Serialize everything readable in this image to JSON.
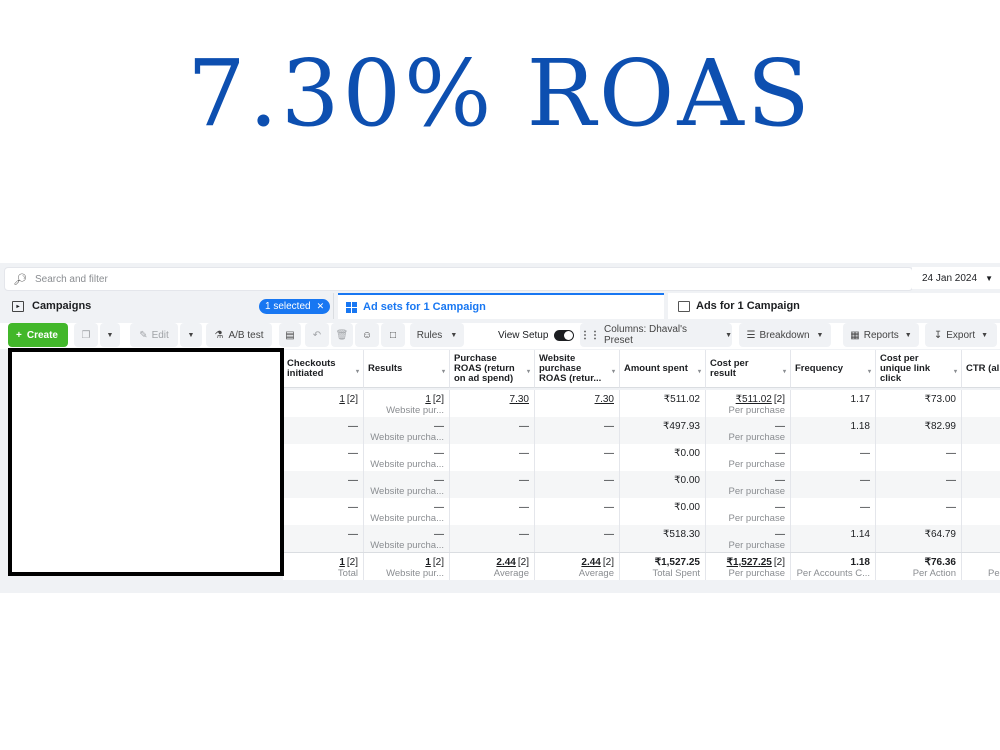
{
  "headline": "7.30% ROAS",
  "search": {
    "placeholder": "Search and filter",
    "date": "24 Jan 2024"
  },
  "tabs": {
    "campaigns": "Campaigns",
    "selected_badge": "1 selected",
    "adsets": "Ad sets for 1 Campaign",
    "ads": "Ads for 1 Campaign"
  },
  "toolbar": {
    "create": "Create",
    "edit": "Edit",
    "ab_test": "A/B test",
    "rules": "Rules",
    "view_setup": "View Setup",
    "columns": "Columns: Dhaval's Preset",
    "breakdown": "Breakdown",
    "reports": "Reports",
    "export": "Export"
  },
  "columns": [
    {
      "l1": "Checkouts",
      "l2": "initiated",
      "l3": ""
    },
    {
      "l1": "Results",
      "l2": "",
      "l3": ""
    },
    {
      "l1": "Purchase",
      "l2": "ROAS (return",
      "l3": "on ad spend)"
    },
    {
      "l1": "Website",
      "l2": "purchase",
      "l3": "ROAS (retur..."
    },
    {
      "l1": "Amount spent",
      "l2": "",
      "l3": ""
    },
    {
      "l1": "Cost per",
      "l2": "result",
      "l3": ""
    },
    {
      "l1": "Frequency",
      "l2": "",
      "l3": ""
    },
    {
      "l1": "Cost per",
      "l2": "unique link",
      "l3": "click"
    },
    {
      "l1": "CTR (al",
      "l2": "",
      "l3": ""
    }
  ],
  "rows": [
    [
      {
        "top": "1",
        "note": "[2]",
        "sub": ""
      },
      {
        "top": "1",
        "note": "[2]",
        "sub": "Website pur..."
      },
      {
        "top": "7.30",
        "note": "",
        "sub": ""
      },
      {
        "top": "7.30",
        "note": "",
        "sub": ""
      },
      {
        "top": "₹511.02",
        "note": "",
        "sub": ""
      },
      {
        "top": "₹511.02",
        "note": "[2]",
        "sub": "Per purchase"
      },
      {
        "top": "1.17",
        "note": "",
        "sub": ""
      },
      {
        "top": "₹73.00",
        "note": "",
        "sub": ""
      },
      {
        "top": "",
        "note": "",
        "sub": ""
      }
    ],
    [
      {
        "top": "—",
        "note": "",
        "sub": ""
      },
      {
        "top": "—",
        "note": "",
        "sub": "Website purcha..."
      },
      {
        "top": "—",
        "note": "",
        "sub": ""
      },
      {
        "top": "—",
        "note": "",
        "sub": ""
      },
      {
        "top": "₹497.93",
        "note": "",
        "sub": ""
      },
      {
        "top": "—",
        "note": "",
        "sub": "Per purchase"
      },
      {
        "top": "1.18",
        "note": "",
        "sub": ""
      },
      {
        "top": "₹82.99",
        "note": "",
        "sub": ""
      },
      {
        "top": "",
        "note": "",
        "sub": ""
      }
    ],
    [
      {
        "top": "—",
        "note": "",
        "sub": ""
      },
      {
        "top": "—",
        "note": "",
        "sub": "Website purcha..."
      },
      {
        "top": "—",
        "note": "",
        "sub": ""
      },
      {
        "top": "—",
        "note": "",
        "sub": ""
      },
      {
        "top": "₹0.00",
        "note": "",
        "sub": ""
      },
      {
        "top": "—",
        "note": "",
        "sub": "Per purchase"
      },
      {
        "top": "—",
        "note": "",
        "sub": ""
      },
      {
        "top": "—",
        "note": "",
        "sub": ""
      },
      {
        "top": "—",
        "note": "",
        "sub": ""
      }
    ],
    [
      {
        "top": "—",
        "note": "",
        "sub": ""
      },
      {
        "top": "—",
        "note": "",
        "sub": "Website purcha..."
      },
      {
        "top": "—",
        "note": "",
        "sub": ""
      },
      {
        "top": "—",
        "note": "",
        "sub": ""
      },
      {
        "top": "₹0.00",
        "note": "",
        "sub": ""
      },
      {
        "top": "—",
        "note": "",
        "sub": "Per purchase"
      },
      {
        "top": "—",
        "note": "",
        "sub": ""
      },
      {
        "top": "—",
        "note": "",
        "sub": ""
      },
      {
        "top": "—",
        "note": "",
        "sub": ""
      }
    ],
    [
      {
        "top": "—",
        "note": "",
        "sub": ""
      },
      {
        "top": "—",
        "note": "",
        "sub": "Website purcha..."
      },
      {
        "top": "—",
        "note": "",
        "sub": ""
      },
      {
        "top": "—",
        "note": "",
        "sub": ""
      },
      {
        "top": "₹0.00",
        "note": "",
        "sub": ""
      },
      {
        "top": "—",
        "note": "",
        "sub": "Per purchase"
      },
      {
        "top": "—",
        "note": "",
        "sub": ""
      },
      {
        "top": "—",
        "note": "",
        "sub": ""
      },
      {
        "top": "—",
        "note": "",
        "sub": ""
      }
    ],
    [
      {
        "top": "—",
        "note": "",
        "sub": ""
      },
      {
        "top": "—",
        "note": "",
        "sub": "Website purcha..."
      },
      {
        "top": "—",
        "note": "",
        "sub": ""
      },
      {
        "top": "—",
        "note": "",
        "sub": ""
      },
      {
        "top": "₹518.30",
        "note": "",
        "sub": ""
      },
      {
        "top": "—",
        "note": "",
        "sub": "Per purchase"
      },
      {
        "top": "1.14",
        "note": "",
        "sub": ""
      },
      {
        "top": "₹64.79",
        "note": "",
        "sub": ""
      },
      {
        "top": "—",
        "note": "",
        "sub": ""
      }
    ]
  ],
  "totals": [
    {
      "top": "1",
      "note": "[2]",
      "sub": "Total"
    },
    {
      "top": "1",
      "note": "[2]",
      "sub": "Website pur..."
    },
    {
      "top": "2.44",
      "note": "[2]",
      "sub": "Average"
    },
    {
      "top": "2.44",
      "note": "[2]",
      "sub": "Average"
    },
    {
      "top": "₹1,527.25",
      "note": "",
      "sub": "Total Spent"
    },
    {
      "top": "₹1,527.25",
      "note": "[2]",
      "sub": "Per purchase"
    },
    {
      "top": "1.18",
      "note": "",
      "sub": "Per Accounts C..."
    },
    {
      "top": "₹76.36",
      "note": "",
      "sub": "Per Action"
    },
    {
      "top": "",
      "note": "",
      "sub": "Per Im"
    }
  ],
  "colors": {
    "headline": "#0d4fb0",
    "accent": "#1877f2",
    "create": "#42b72a"
  }
}
